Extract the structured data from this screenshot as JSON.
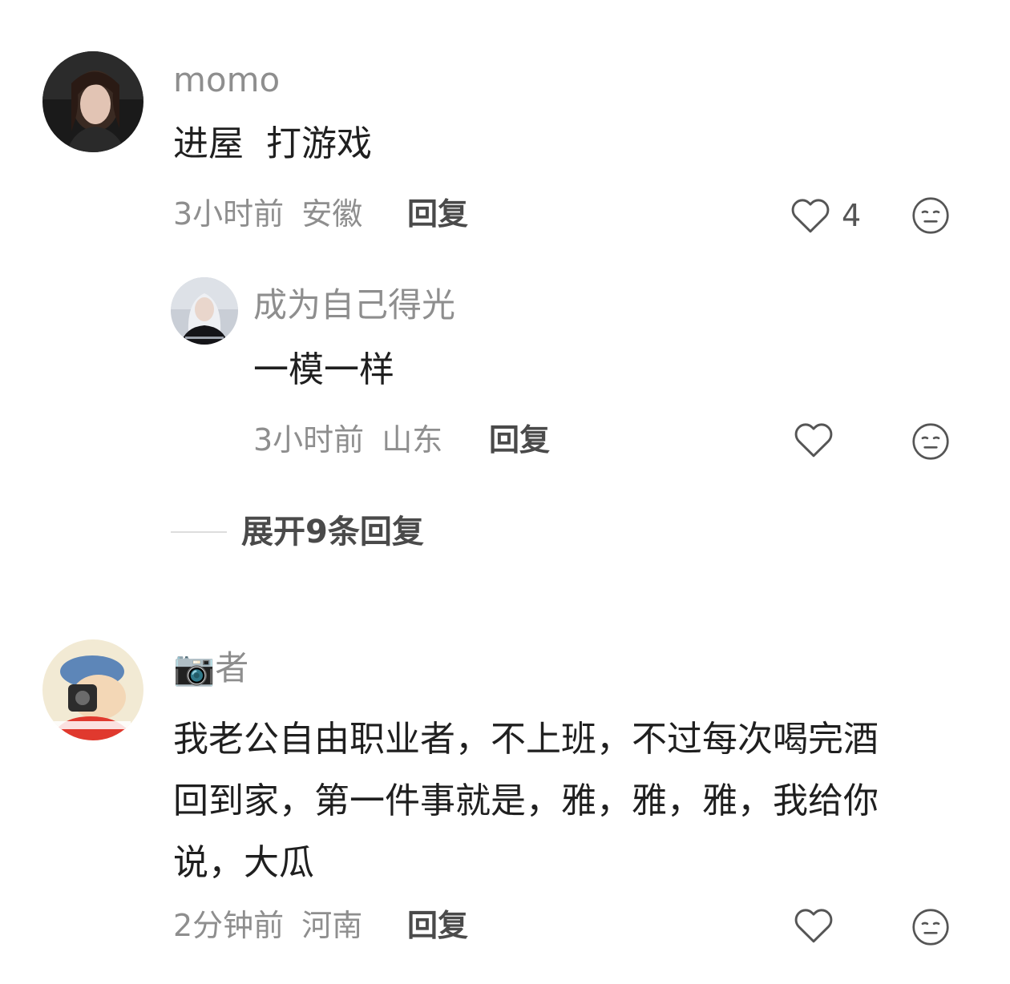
{
  "comments": [
    {
      "username": "momo",
      "text": "进屋  打游戏",
      "time": "3小时前",
      "location": "安徽",
      "reply_label": "回复",
      "like_count": "4"
    },
    {
      "username": "成为自己得光",
      "text": "一模一样",
      "time": "3小时前",
      "location": "山东",
      "reply_label": "回复",
      "like_count": ""
    },
    {
      "username": "📷者",
      "text_lines": [
        "我老公自由职业者，不上班，不过每次喝完酒",
        "回到家，第一件事就是，雅，雅，雅，我给你",
        "说，大瓜"
      ],
      "time": "2分钟前",
      "location": "河南",
      "reply_label": "回复",
      "like_count": ""
    }
  ],
  "expand_replies": {
    "label": "展开9条回复"
  },
  "icons": {
    "like": "heart-outline-icon",
    "dislike": "neutral-face-icon"
  },
  "colors": {
    "text_primary": "#1f1f1f",
    "text_secondary": "#8e8e8e",
    "reply": "#4a4a4a",
    "icon": "#555555",
    "divider": "#dddddd"
  }
}
